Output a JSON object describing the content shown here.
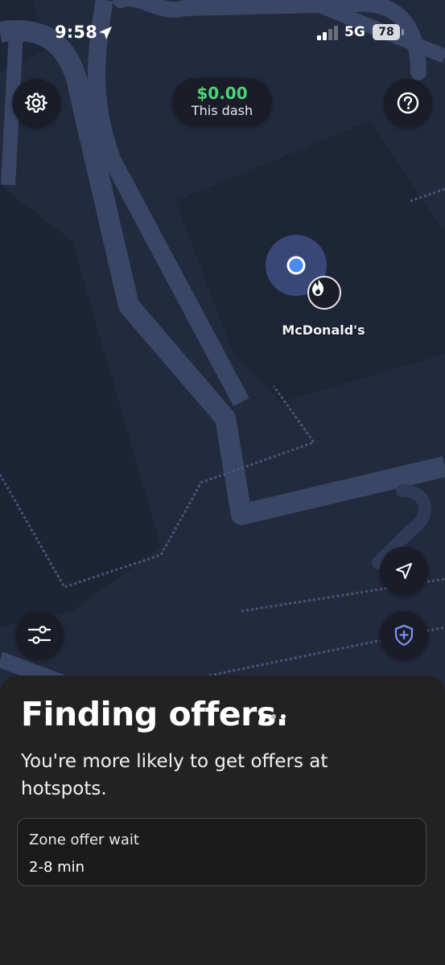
{
  "status_bar": {
    "time": "9:58",
    "network": "5G",
    "battery": "78"
  },
  "map": {
    "earnings_amount": "$0.00",
    "earnings_label": "This dash",
    "place_name": "McDonald's"
  },
  "sheet": {
    "title": "Finding offers.",
    "subtitle": "You're more likely to get offers at hotspots.",
    "wait_label": "Zone offer wait",
    "wait_value": "2-8 min"
  },
  "colors": {
    "map_background": "#222a3d",
    "road": "#3a4666",
    "earnings_green": "#4fd27b",
    "user_dot": "#4a8bf2",
    "safety_shield": "#7b8ff0",
    "sheet_background": "#222222"
  },
  "icons": [
    "gear-icon",
    "help-icon",
    "location-arrow-icon",
    "hotspot-flame-icon",
    "navigation-arrow-icon",
    "filter-sliders-icon",
    "safety-shield-icon"
  ]
}
